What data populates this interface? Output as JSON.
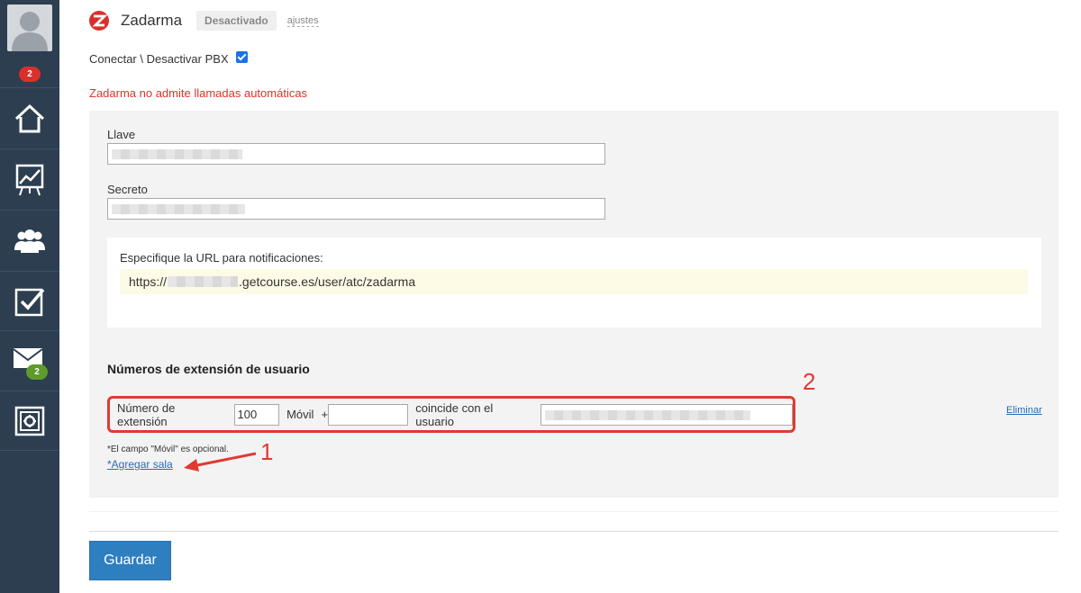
{
  "sidebar": {
    "avatar_badge": "2",
    "items": [
      {
        "name": "home-icon"
      },
      {
        "name": "chart-icon"
      },
      {
        "name": "users-icon"
      },
      {
        "name": "tasks-icon"
      },
      {
        "name": "mail-icon",
        "badge": "2"
      },
      {
        "name": "safe-icon"
      }
    ]
  },
  "header": {
    "title": "Zadarma",
    "status": "Desactivado",
    "settings_link": "ajustes",
    "logo_color": "#d9302c"
  },
  "pbx": {
    "label": "Conectar \\ Desactivar PBX",
    "checked": true
  },
  "warning": "Zadarma no admite llamadas automáticas",
  "form": {
    "key_label": "Llave",
    "secret_label": "Secreto",
    "url_label": "Especifique la URL para notificaciones:",
    "url_prefix": "https://",
    "url_suffix": ".getcourse.es/user/atc/zadarma"
  },
  "extensions": {
    "title": "Números de extensión de usuario",
    "ext_label": "Número de extensión",
    "ext_value": "100",
    "mobile_label": "Móvil",
    "mobile_prefix": "+",
    "mobile_value": "",
    "match_label": "coincide con el usuario",
    "delete_label": "Eliminar",
    "note": "*El campo \"Móvil\" es opcional.",
    "add_room": "*Agregar sala"
  },
  "annotations": {
    "one": "1",
    "two": "2",
    "color": "#e03a33"
  },
  "save_button": "Guardar"
}
